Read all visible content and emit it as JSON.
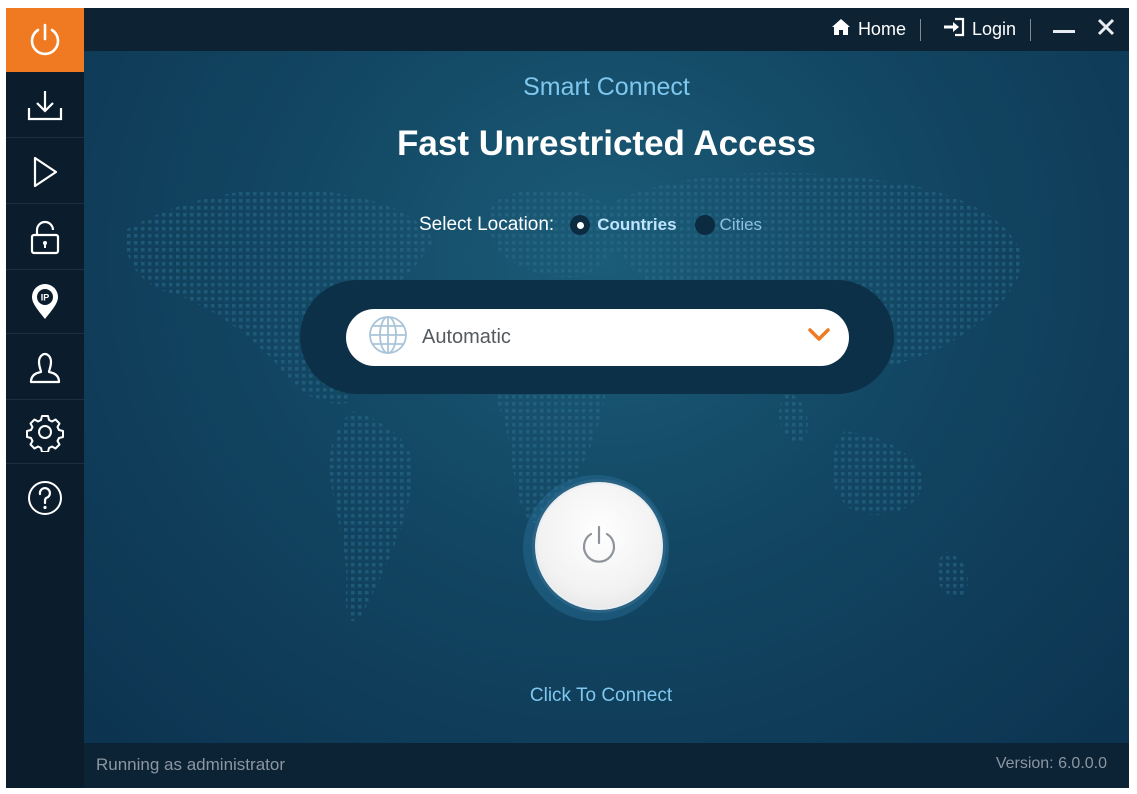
{
  "sidebar": {
    "items": [
      {
        "icon": "power-icon",
        "active": true
      },
      {
        "icon": "download-icon",
        "active": false
      },
      {
        "icon": "play-icon",
        "active": false
      },
      {
        "icon": "lock-icon",
        "active": false
      },
      {
        "icon": "ip-location-icon",
        "active": false
      },
      {
        "icon": "user-icon",
        "active": false
      },
      {
        "icon": "gear-icon",
        "active": false
      },
      {
        "icon": "help-icon",
        "active": false
      }
    ]
  },
  "topbar": {
    "home_label": "Home",
    "login_label": "Login"
  },
  "main": {
    "subtitle": "Smart Connect",
    "title": "Fast Unrestricted Access",
    "location": {
      "label": "Select Location:",
      "options": [
        {
          "label": "Countries",
          "selected": true
        },
        {
          "label": "Cities",
          "selected": false
        }
      ]
    },
    "server_select": {
      "value": "Automatic"
    },
    "connect_label": "Click To Connect"
  },
  "footer": {
    "status": "Running as administrator",
    "version": "Version:  6.0.0.0"
  },
  "colors": {
    "accent": "#f07a22",
    "sidebar_bg": "#0b1d2c",
    "main_bg": "#124662",
    "link_blue": "#7fc7ee"
  }
}
